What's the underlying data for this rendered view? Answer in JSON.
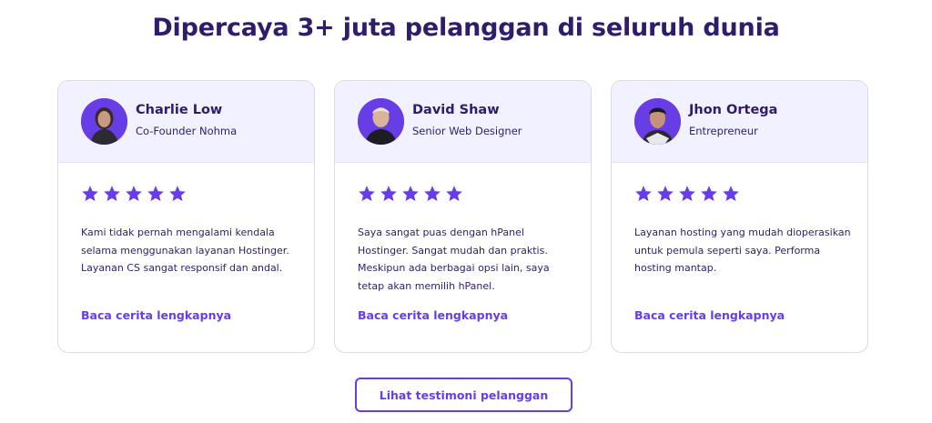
{
  "heading": "Dipercaya 3+ juta pelanggan di seluruh dunia",
  "colors": {
    "accent": "#673de6",
    "text": "#2f1c6a",
    "card_header": "#f1f1ff"
  },
  "testimonials": [
    {
      "name": "Charlie Low",
      "role": "Co-Founder Nohma",
      "rating": 5,
      "quote": "Kami tidak pernah mengalami kendala selama menggunakan layanan Hostinger. Layanan CS sangat responsif dan andal.",
      "link": "Baca cerita lengkapnya"
    },
    {
      "name": "David Shaw",
      "role": "Senior Web Designer",
      "rating": 5,
      "quote": "Saya sangat puas dengan hPanel Hostinger. Sangat mudah dan praktis. Meskipun ada berbagai opsi lain, saya tetap akan memilih hPanel.",
      "link": "Baca cerita lengkapnya"
    },
    {
      "name": "Jhon Ortega",
      "role": "Entrepreneur",
      "rating": 5,
      "quote": "Layanan hosting yang mudah dioperasikan untuk pemula seperti saya. Performa hosting mantap.",
      "link": "Baca cerita lengkapnya"
    }
  ],
  "cta_label": "Lihat testimoni pelanggan"
}
